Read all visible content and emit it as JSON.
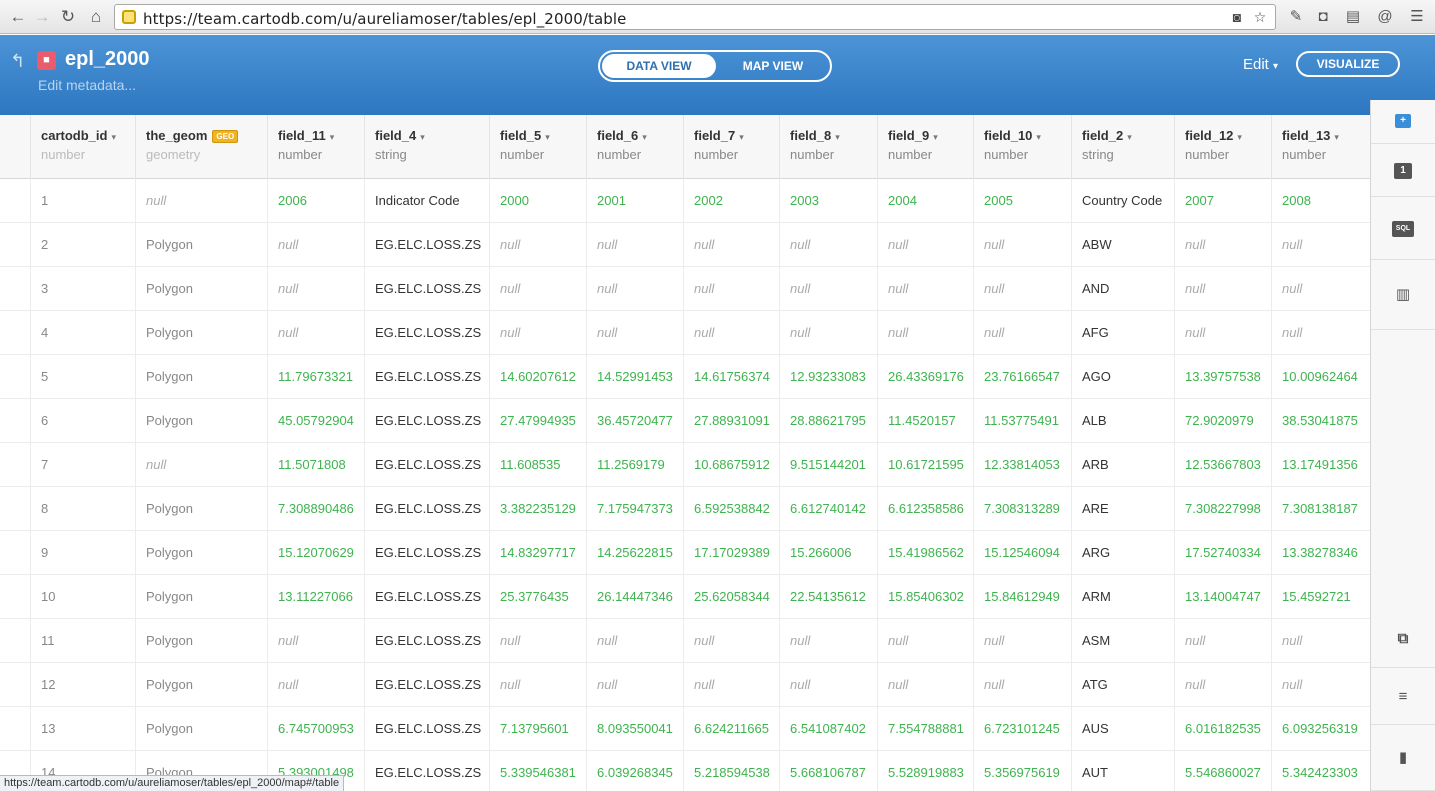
{
  "browser": {
    "url": "https://team.cartodb.com/u/aureliamoser/tables/epl_2000/table",
    "status_url": "https://team.cartodb.com/u/aureliamoser/tables/epl_2000/map#/table"
  },
  "header": {
    "title": "epl_2000",
    "subtitle": "Edit metadata...",
    "data_view_label": "DATA VIEW",
    "map_view_label": "MAP VIEW",
    "edit_label": "Edit",
    "visualize_label": "VISUALIZE"
  },
  "columns": [
    {
      "name": "cartodb_id",
      "type": "number"
    },
    {
      "name": "the_geom",
      "type": "geometry",
      "badge": "GEO"
    },
    {
      "name": "field_11",
      "type": "number"
    },
    {
      "name": "field_4",
      "type": "string"
    },
    {
      "name": "field_5",
      "type": "number"
    },
    {
      "name": "field_6",
      "type": "number"
    },
    {
      "name": "field_7",
      "type": "number"
    },
    {
      "name": "field_8",
      "type": "number"
    },
    {
      "name": "field_9",
      "type": "number"
    },
    {
      "name": "field_10",
      "type": "number"
    },
    {
      "name": "field_2",
      "type": "string"
    },
    {
      "name": "field_12",
      "type": "number"
    },
    {
      "name": "field_13",
      "type": "number"
    }
  ],
  "rows": [
    [
      "1",
      "null",
      "2006",
      "Indicator Code",
      "2000",
      "2001",
      "2002",
      "2003",
      "2004",
      "2005",
      "Country Code",
      "2007",
      "2008"
    ],
    [
      "2",
      "Polygon",
      "null",
      "EG.ELC.LOSS.ZS",
      "null",
      "null",
      "null",
      "null",
      "null",
      "null",
      "ABW",
      "null",
      "null"
    ],
    [
      "3",
      "Polygon",
      "null",
      "EG.ELC.LOSS.ZS",
      "null",
      "null",
      "null",
      "null",
      "null",
      "null",
      "AND",
      "null",
      "null"
    ],
    [
      "4",
      "Polygon",
      "null",
      "EG.ELC.LOSS.ZS",
      "null",
      "null",
      "null",
      "null",
      "null",
      "null",
      "AFG",
      "null",
      "null"
    ],
    [
      "5",
      "Polygon",
      "11.79673321",
      "EG.ELC.LOSS.ZS",
      "14.60207612",
      "14.52991453",
      "14.61756374",
      "12.93233083",
      "26.43369176",
      "23.76166547",
      "AGO",
      "13.39757538",
      "10.00962464"
    ],
    [
      "6",
      "Polygon",
      "45.05792904",
      "EG.ELC.LOSS.ZS",
      "27.47994935",
      "36.45720477",
      "27.88931091",
      "28.88621795",
      "11.4520157",
      "11.53775491",
      "ALB",
      "72.9020979",
      "38.53041875"
    ],
    [
      "7",
      "null",
      "11.5071808",
      "EG.ELC.LOSS.ZS",
      "11.608535",
      "11.2569179",
      "10.68675912",
      "9.515144201",
      "10.61721595",
      "12.33814053",
      "ARB",
      "12.53667803",
      "13.17491356"
    ],
    [
      "8",
      "Polygon",
      "7.308890486",
      "EG.ELC.LOSS.ZS",
      "3.382235129",
      "7.175947373",
      "6.592538842",
      "6.612740142",
      "6.612358586",
      "7.308313289",
      "ARE",
      "7.308227998",
      "7.308138187"
    ],
    [
      "9",
      "Polygon",
      "15.12070629",
      "EG.ELC.LOSS.ZS",
      "14.83297717",
      "14.25622815",
      "17.17029389",
      "15.266006",
      "15.41986562",
      "15.12546094",
      "ARG",
      "17.52740334",
      "13.38278346"
    ],
    [
      "10",
      "Polygon",
      "13.11227066",
      "EG.ELC.LOSS.ZS",
      "25.3776435",
      "26.14447346",
      "25.62058344",
      "22.54135612",
      "15.85406302",
      "15.84612949",
      "ARM",
      "13.14004747",
      "15.4592721"
    ],
    [
      "11",
      "Polygon",
      "null",
      "EG.ELC.LOSS.ZS",
      "null",
      "null",
      "null",
      "null",
      "null",
      "null",
      "ASM",
      "null",
      "null"
    ],
    [
      "12",
      "Polygon",
      "null",
      "EG.ELC.LOSS.ZS",
      "null",
      "null",
      "null",
      "null",
      "null",
      "null",
      "ATG",
      "null",
      "null"
    ],
    [
      "13",
      "Polygon",
      "6.745700953",
      "EG.ELC.LOSS.ZS",
      "7.13795601",
      "8.093550041",
      "6.624211665",
      "6.541087402",
      "7.554788881",
      "6.723101245",
      "AUS",
      "6.016182535",
      "6.093256319"
    ],
    [
      "14",
      "Polygon",
      "5.393001498",
      "EG.ELC.LOSS.ZS",
      "5.339546381",
      "6.039268345",
      "5.218594538",
      "5.668106787",
      "5.528919883",
      "5.356975619",
      "AUT",
      "5.546860027",
      "5.342423303"
    ]
  ],
  "side_tools": [
    {
      "name": "add-icon",
      "glyph": "+"
    },
    {
      "name": "layer-1-icon",
      "glyph": "1"
    },
    {
      "name": "sql-icon",
      "glyph": "SQL"
    },
    {
      "name": "chart-icon",
      "glyph": "▥"
    },
    {
      "name": "merge-icon",
      "glyph": "⧉"
    },
    {
      "name": "filter-icon",
      "glyph": "≡"
    },
    {
      "name": "bookmark-icon",
      "glyph": "▮"
    }
  ],
  "colors": {
    "header_top": "#4d94d6",
    "header_bottom": "#2c77c1",
    "number_text": "#3fb34f",
    "null_text": "#aaaaaa"
  }
}
